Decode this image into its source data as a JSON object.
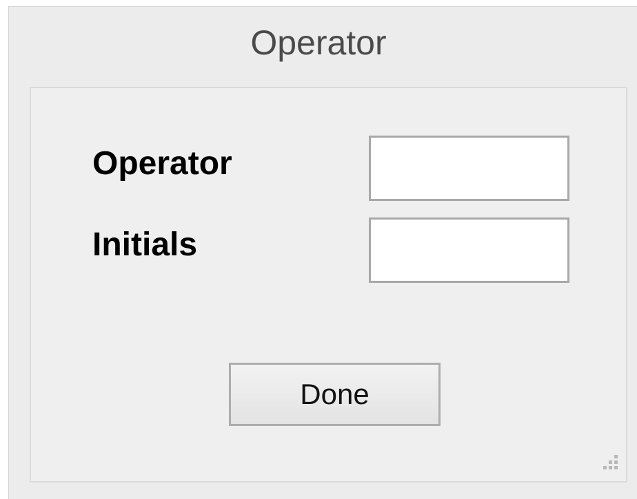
{
  "dialog": {
    "title": "Operator"
  },
  "form": {
    "operator_label": "Operator",
    "operator_value": "",
    "initials_label": "Initials",
    "initials_value": ""
  },
  "actions": {
    "done_label": "Done"
  },
  "icons": {
    "resize_grip": "resize-grip-icon"
  }
}
